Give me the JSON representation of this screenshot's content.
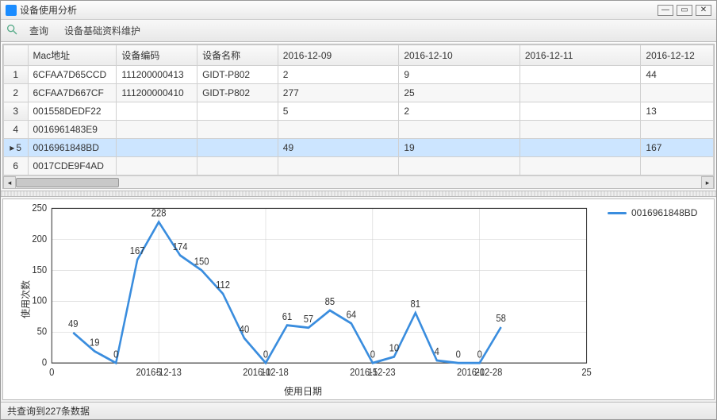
{
  "window": {
    "title": "设备使用分析"
  },
  "toolbar": {
    "query": "查询",
    "maintain": "设备基础资料维护"
  },
  "grid": {
    "columns": [
      "Mac地址",
      "设备编码",
      "设备名称",
      "2016-12-09",
      "2016-12-10",
      "2016-12-11",
      "2016-12-12"
    ],
    "rows": [
      {
        "n": "1",
        "cells": [
          "6CFAA7D65CCD",
          "111200000413",
          "GIDT-P802",
          "2",
          "9",
          "",
          "44"
        ],
        "selected": false
      },
      {
        "n": "2",
        "cells": [
          "6CFAA7D667CF",
          "111200000410",
          "GIDT-P802",
          "277",
          "25",
          "",
          ""
        ],
        "selected": false
      },
      {
        "n": "3",
        "cells": [
          "001558DEDF22",
          "",
          "",
          "5",
          "2",
          "",
          "13"
        ],
        "selected": false
      },
      {
        "n": "4",
        "cells": [
          "0016961483E9",
          "",
          "",
          "",
          "",
          "",
          ""
        ],
        "selected": false
      },
      {
        "n": "5",
        "cells": [
          "0016961848BD",
          "",
          "",
          "49",
          "19",
          "",
          "167"
        ],
        "selected": true
      },
      {
        "n": "6",
        "cells": [
          "0017CDE9F4AD",
          "",
          "",
          "",
          "",
          "",
          ""
        ],
        "selected": false
      }
    ]
  },
  "chart_data": {
    "type": "line",
    "title": "",
    "xlabel": "使用日期",
    "ylabel": "使用次数",
    "series_name": "0016961848BD",
    "ylim": [
      0,
      250
    ],
    "yticks": [
      0,
      50,
      100,
      150,
      200,
      250
    ],
    "xlim": [
      0,
      25
    ],
    "xticks_num": [
      0,
      5,
      10,
      15,
      20,
      25
    ],
    "xticks_date": [
      "2016-12-13",
      "2016-12-18",
      "2016-12-23",
      "2016-12-28"
    ],
    "xticks_date_pos": [
      5,
      10,
      15,
      20
    ],
    "x": [
      1,
      2,
      3,
      4,
      5,
      6,
      7,
      8,
      9,
      10,
      11,
      12,
      13,
      14,
      15,
      16,
      17,
      18,
      19,
      20,
      21
    ],
    "values": [
      49,
      19,
      0,
      167,
      228,
      174,
      150,
      112,
      40,
      0,
      61,
      57,
      85,
      64,
      0,
      10,
      81,
      4,
      0,
      0,
      58
    ]
  },
  "status": {
    "text": "共查询到227条数据"
  }
}
